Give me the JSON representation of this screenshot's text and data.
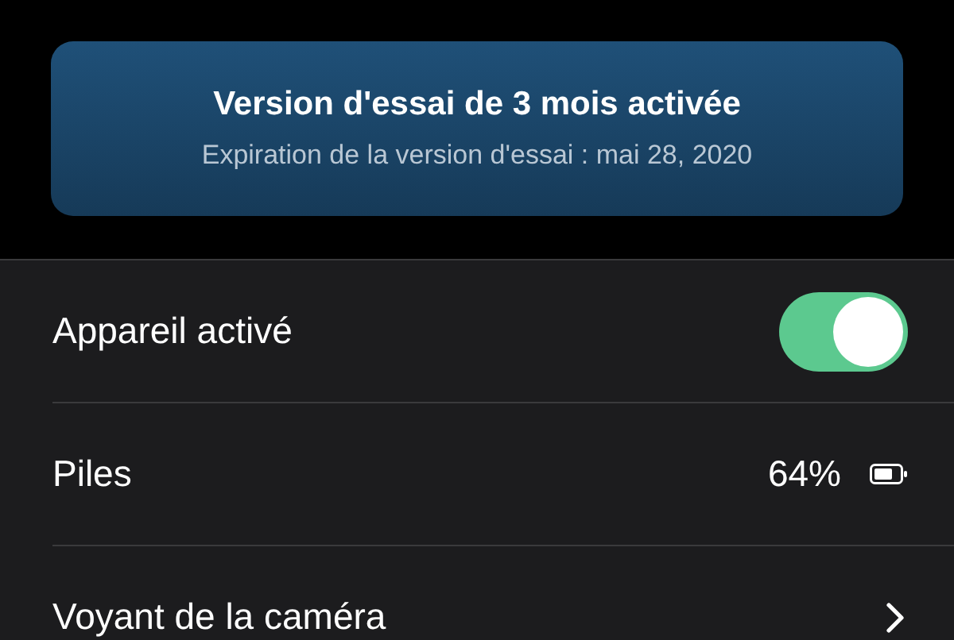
{
  "banner": {
    "title": "Version d'essai de 3 mois activée",
    "subtitle": "Expiration de la version d'essai : mai 28, 2020"
  },
  "rows": [
    {
      "kind": "toggle",
      "label": "Appareil activé",
      "on": true
    },
    {
      "kind": "value",
      "label": "Piles",
      "value": "64%"
    },
    {
      "kind": "link",
      "label": "Voyant de la caméra"
    }
  ]
}
